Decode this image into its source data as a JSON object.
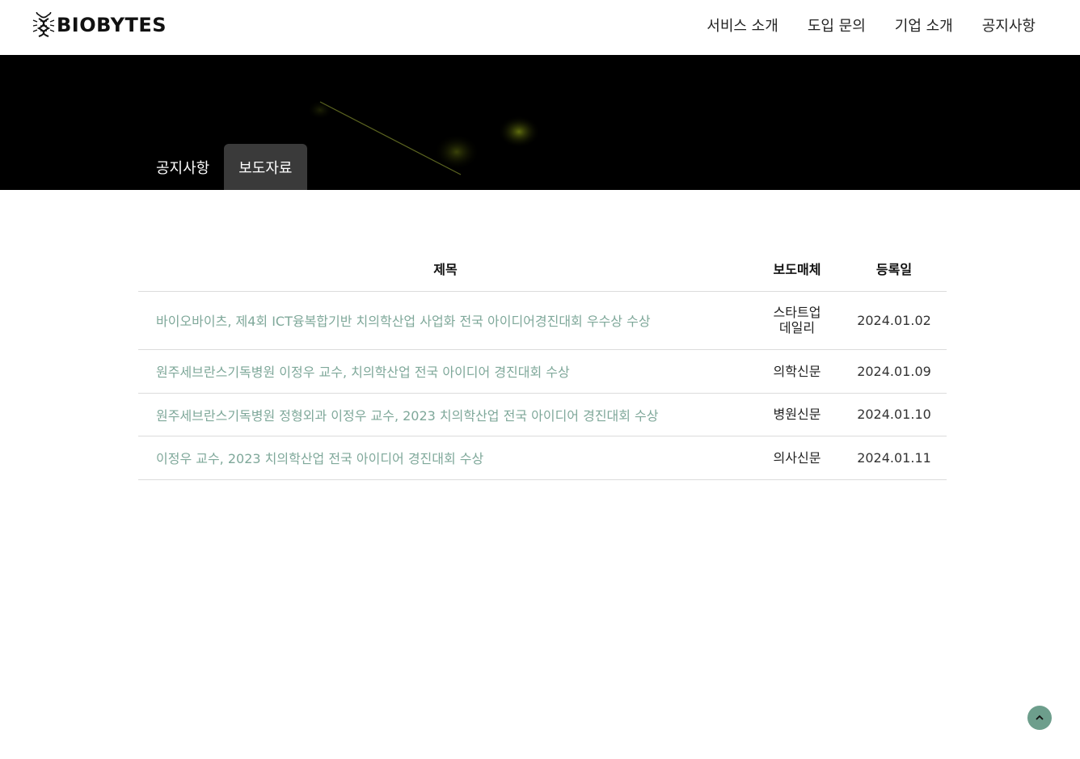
{
  "brand": {
    "name": "BIOBYTES",
    "logo_icon": "dna-bug-icon"
  },
  "nav": {
    "items": [
      {
        "label": "서비스 소개"
      },
      {
        "label": "도입 문의"
      },
      {
        "label": "기업 소개"
      },
      {
        "label": "공지사항"
      }
    ]
  },
  "tabs": [
    {
      "label": "공지사항",
      "active": false
    },
    {
      "label": "보도자료",
      "active": true
    }
  ],
  "table": {
    "headers": {
      "title": "제목",
      "media": "보도매체",
      "date": "등록일"
    },
    "rows": [
      {
        "title": "바이오바이츠, 제4회 ICT융복합기반 치의학산업 사업화 전국 아이디어경진대회 우수상 수상",
        "media": "스타트업\n데일리",
        "date": "2024.01.02"
      },
      {
        "title": "원주세브란스기독병원 이정우 교수, 치의학산업 전국 아이디어 경진대회 수상",
        "media": "의학신문",
        "date": "2024.01.09"
      },
      {
        "title": "원주세브란스기독병원 정형외과 이정우 교수, 2023 치의학산업 전국 아이디어 경진대회 수상",
        "media": "병원신문",
        "date": "2024.01.10"
      },
      {
        "title": "이정우 교수, 2023 치의학산업 전국 아이디어 경진대회 수상",
        "media": "의사신문",
        "date": "2024.01.11"
      }
    ]
  },
  "scroll_top": {
    "icon": "chevron-up-icon"
  },
  "colors": {
    "link": "#7fa89a",
    "accent": "#6d9e8c",
    "hero_bg": "#000000",
    "active_tab": "#3a3a3a"
  }
}
